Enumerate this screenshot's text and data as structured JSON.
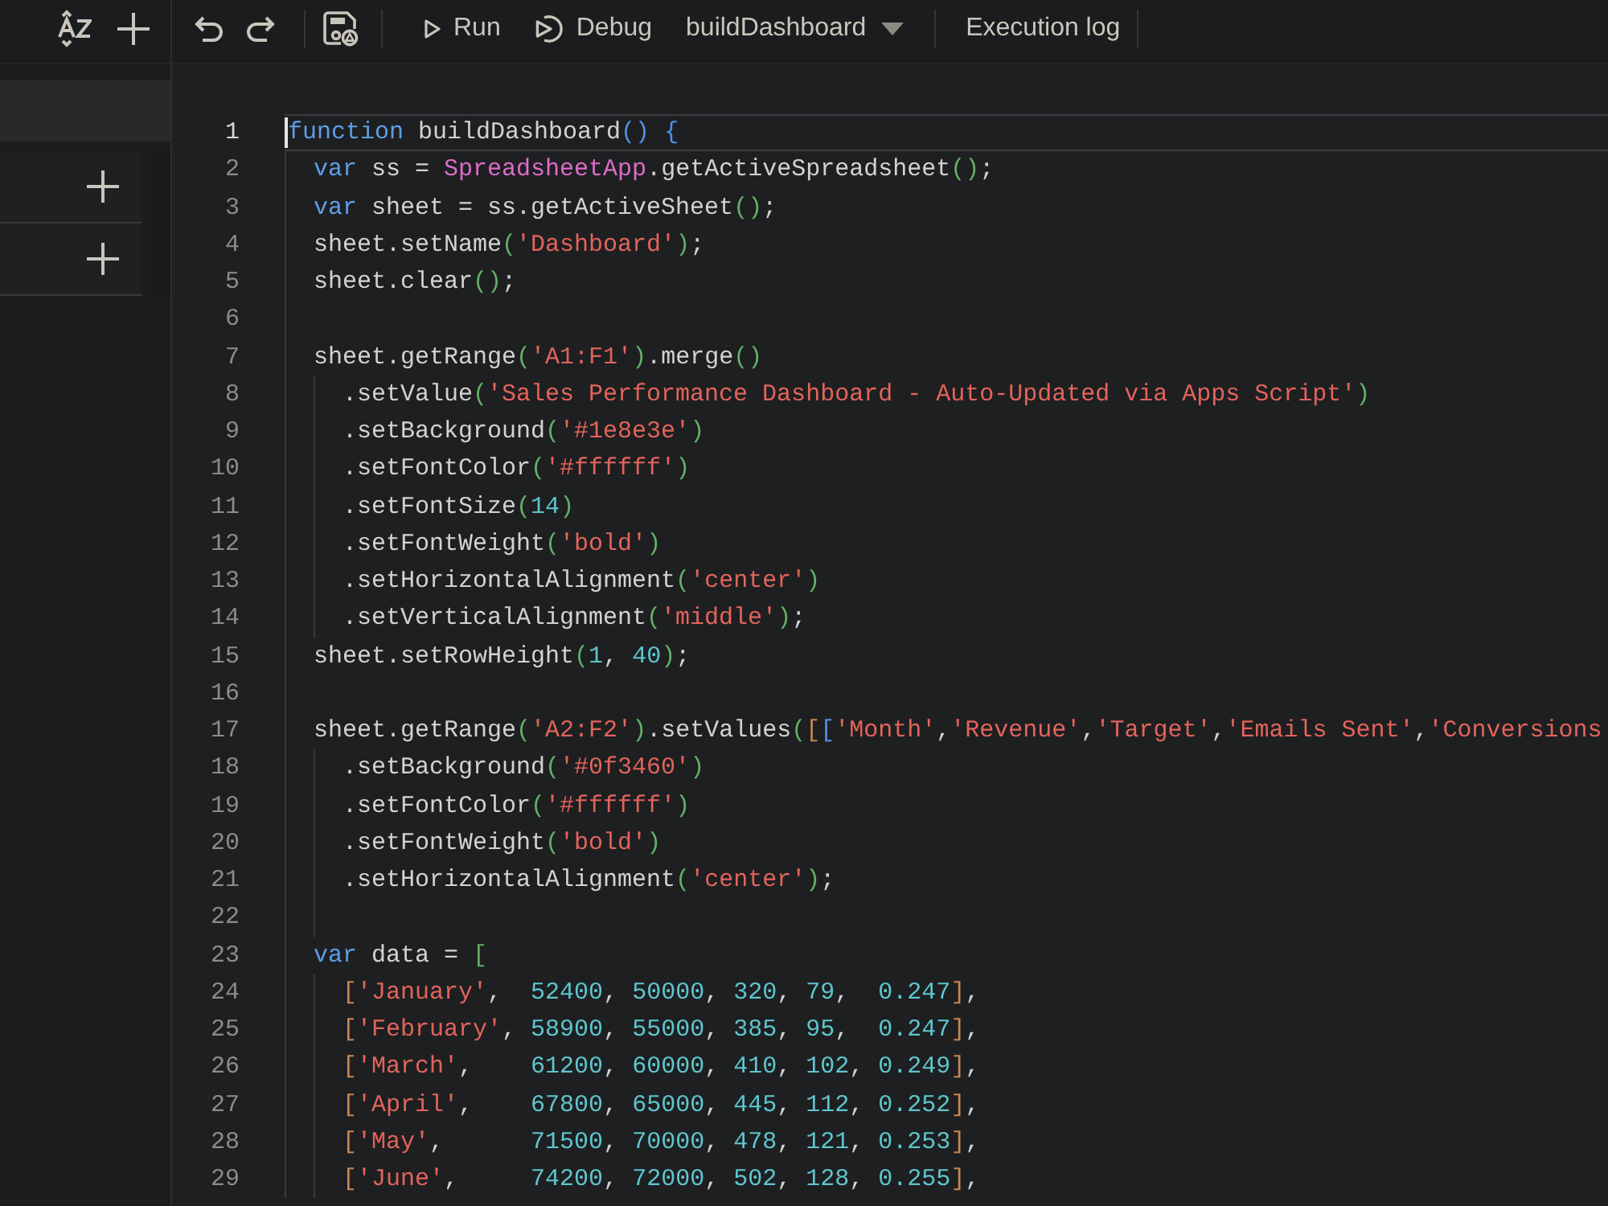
{
  "toolbar": {
    "run": "Run",
    "debug": "Debug",
    "function_select": "buildDashboard",
    "execution_log": "Execution log"
  },
  "sidebar": {
    "rows": [
      {
        "kind": "file"
      },
      {
        "kind": "section"
      },
      {
        "kind": "section"
      }
    ]
  },
  "editor": {
    "lines": [
      {
        "number": "1",
        "current": true,
        "tokens": [
          {
            "kind": "keyword",
            "text": "function"
          },
          {
            "kind": "plain",
            "text": " buildDashboard"
          },
          {
            "kind": "bracket1",
            "text": "()"
          },
          {
            "kind": "bracket1",
            "text": " {"
          }
        ]
      },
      {
        "number": "2",
        "current": false,
        "tokens": [
          {
            "kind": "keyword",
            "text": "  var"
          },
          {
            "kind": "plain",
            "text": " ss = "
          },
          {
            "kind": "type",
            "text": "SpreadsheetApp"
          },
          {
            "kind": "plain",
            "text": ".getActiveSpreadsheet"
          },
          {
            "kind": "bracket2",
            "text": "()"
          },
          {
            "kind": "plain",
            "text": ";"
          }
        ]
      },
      {
        "number": "3",
        "current": false,
        "tokens": [
          {
            "kind": "keyword",
            "text": "  var"
          },
          {
            "kind": "plain",
            "text": " sheet = ss.getActiveSheet"
          },
          {
            "kind": "bracket2",
            "text": "()"
          },
          {
            "kind": "plain",
            "text": ";"
          }
        ]
      },
      {
        "number": "4",
        "current": false,
        "tokens": [
          {
            "kind": "plain",
            "text": "  sheet.setName"
          },
          {
            "kind": "bracket2",
            "text": "("
          },
          {
            "kind": "string",
            "text": "'Dashboard'"
          },
          {
            "kind": "bracket2",
            "text": ")"
          },
          {
            "kind": "plain",
            "text": ";"
          }
        ]
      },
      {
        "number": "5",
        "current": false,
        "tokens": [
          {
            "kind": "plain",
            "text": "  sheet.clear"
          },
          {
            "kind": "bracket2",
            "text": "()"
          },
          {
            "kind": "plain",
            "text": ";"
          }
        ]
      },
      {
        "number": "6",
        "current": false
      },
      {
        "number": "7",
        "current": false,
        "tokens": [
          {
            "kind": "plain",
            "text": "  sheet.getRange"
          },
          {
            "kind": "bracket2",
            "text": "("
          },
          {
            "kind": "string",
            "text": "'A1:F1'"
          },
          {
            "kind": "bracket2",
            "text": ")"
          },
          {
            "kind": "plain",
            "text": ".merge"
          },
          {
            "kind": "bracket2",
            "text": "()"
          }
        ]
      },
      {
        "number": "8",
        "current": false,
        "tokens": [
          {
            "kind": "plain",
            "text": "    .setValue"
          },
          {
            "kind": "bracket2",
            "text": "("
          },
          {
            "kind": "string",
            "text": "'Sales Performance Dashboard - Auto-Updated via Apps Script'"
          },
          {
            "kind": "bracket2",
            "text": ")"
          }
        ]
      },
      {
        "number": "9",
        "current": false,
        "tokens": [
          {
            "kind": "plain",
            "text": "    .setBackground"
          },
          {
            "kind": "bracket2",
            "text": "("
          },
          {
            "kind": "string",
            "text": "'#1e8e3e'"
          },
          {
            "kind": "bracket2",
            "text": ")"
          }
        ]
      },
      {
        "number": "10",
        "current": false,
        "tokens": [
          {
            "kind": "plain",
            "text": "    .setFontColor"
          },
          {
            "kind": "bracket2",
            "text": "("
          },
          {
            "kind": "string",
            "text": "'#ffffff'"
          },
          {
            "kind": "bracket2",
            "text": ")"
          }
        ]
      },
      {
        "number": "11",
        "current": false,
        "tokens": [
          {
            "kind": "plain",
            "text": "    .setFontSize"
          },
          {
            "kind": "bracket2",
            "text": "("
          },
          {
            "kind": "number",
            "text": "14"
          },
          {
            "kind": "bracket2",
            "text": ")"
          }
        ]
      },
      {
        "number": "12",
        "current": false,
        "tokens": [
          {
            "kind": "plain",
            "text": "    .setFontWeight"
          },
          {
            "kind": "bracket2",
            "text": "("
          },
          {
            "kind": "string",
            "text": "'bold'"
          },
          {
            "kind": "bracket2",
            "text": ")"
          }
        ]
      },
      {
        "number": "13",
        "current": false,
        "tokens": [
          {
            "kind": "plain",
            "text": "    .setHorizontalAlignment"
          },
          {
            "kind": "bracket2",
            "text": "("
          },
          {
            "kind": "string",
            "text": "'center'"
          },
          {
            "kind": "bracket2",
            "text": ")"
          }
        ]
      },
      {
        "number": "14",
        "current": false,
        "tokens": [
          {
            "kind": "plain",
            "text": "    .setVerticalAlignment"
          },
          {
            "kind": "bracket2",
            "text": "("
          },
          {
            "kind": "string",
            "text": "'middle'"
          },
          {
            "kind": "bracket2",
            "text": ")"
          },
          {
            "kind": "plain",
            "text": ";"
          }
        ]
      },
      {
        "number": "15",
        "current": false,
        "tokens": [
          {
            "kind": "plain",
            "text": "  sheet.setRowHeight"
          },
          {
            "kind": "bracket2",
            "text": "("
          },
          {
            "kind": "number",
            "text": "1"
          },
          {
            "kind": "plain",
            "text": ", "
          },
          {
            "kind": "number",
            "text": "40"
          },
          {
            "kind": "bracket2",
            "text": ")"
          },
          {
            "kind": "plain",
            "text": ";"
          }
        ]
      },
      {
        "number": "16",
        "current": false
      },
      {
        "number": "17",
        "current": false,
        "tokens": [
          {
            "kind": "plain",
            "text": "  sheet.getRange"
          },
          {
            "kind": "bracket2",
            "text": "("
          },
          {
            "kind": "string",
            "text": "'A2:F2'"
          },
          {
            "kind": "bracket2",
            "text": ")"
          },
          {
            "kind": "plain",
            "text": ".setValues"
          },
          {
            "kind": "bracket2",
            "text": "("
          },
          {
            "kind": "bracket3",
            "text": "["
          },
          {
            "kind": "bracket1",
            "text": "["
          },
          {
            "kind": "string",
            "text": "'Month'"
          },
          {
            "kind": "plain",
            "text": ","
          },
          {
            "kind": "string",
            "text": "'Revenue'"
          },
          {
            "kind": "plain",
            "text": ","
          },
          {
            "kind": "string",
            "text": "'Target'"
          },
          {
            "kind": "plain",
            "text": ","
          },
          {
            "kind": "string",
            "text": "'Emails Sent'"
          },
          {
            "kind": "plain",
            "text": ","
          },
          {
            "kind": "string",
            "text": "'Conversions"
          }
        ]
      },
      {
        "number": "18",
        "current": false,
        "tokens": [
          {
            "kind": "plain",
            "text": "    .setBackground"
          },
          {
            "kind": "bracket2",
            "text": "("
          },
          {
            "kind": "string",
            "text": "'#0f3460'"
          },
          {
            "kind": "bracket2",
            "text": ")"
          }
        ]
      },
      {
        "number": "19",
        "current": false,
        "tokens": [
          {
            "kind": "plain",
            "text": "    .setFontColor"
          },
          {
            "kind": "bracket2",
            "text": "("
          },
          {
            "kind": "string",
            "text": "'#ffffff'"
          },
          {
            "kind": "bracket2",
            "text": ")"
          }
        ]
      },
      {
        "number": "20",
        "current": false,
        "tokens": [
          {
            "kind": "plain",
            "text": "    .setFontWeight"
          },
          {
            "kind": "bracket2",
            "text": "("
          },
          {
            "kind": "string",
            "text": "'bold'"
          },
          {
            "kind": "bracket2",
            "text": ")"
          }
        ]
      },
      {
        "number": "21",
        "current": false,
        "tokens": [
          {
            "kind": "plain",
            "text": "    .setHorizontalAlignment"
          },
          {
            "kind": "bracket2",
            "text": "("
          },
          {
            "kind": "string",
            "text": "'center'"
          },
          {
            "kind": "bracket2",
            "text": ")"
          },
          {
            "kind": "plain",
            "text": ";"
          }
        ]
      },
      {
        "number": "22",
        "current": false
      },
      {
        "number": "23",
        "current": false,
        "tokens": [
          {
            "kind": "keyword",
            "text": "  var"
          },
          {
            "kind": "plain",
            "text": " data = "
          },
          {
            "kind": "bracket2",
            "text": "["
          }
        ]
      },
      {
        "number": "24",
        "current": false,
        "tokens": [
          {
            "kind": "bracket3",
            "text": "    ["
          },
          {
            "kind": "string",
            "text": "'January'"
          },
          {
            "kind": "plain",
            "text": ",  "
          },
          {
            "kind": "number",
            "text": "52400"
          },
          {
            "kind": "plain",
            "text": ", "
          },
          {
            "kind": "number",
            "text": "50000"
          },
          {
            "kind": "plain",
            "text": ", "
          },
          {
            "kind": "number",
            "text": "320"
          },
          {
            "kind": "plain",
            "text": ", "
          },
          {
            "kind": "number",
            "text": "79"
          },
          {
            "kind": "plain",
            "text": ",  "
          },
          {
            "kind": "number",
            "text": "0.247"
          },
          {
            "kind": "bracket3",
            "text": "]"
          },
          {
            "kind": "plain",
            "text": ","
          }
        ]
      },
      {
        "number": "25",
        "current": false,
        "tokens": [
          {
            "kind": "bracket3",
            "text": "    ["
          },
          {
            "kind": "string",
            "text": "'February'"
          },
          {
            "kind": "plain",
            "text": ", "
          },
          {
            "kind": "number",
            "text": "58900"
          },
          {
            "kind": "plain",
            "text": ", "
          },
          {
            "kind": "number",
            "text": "55000"
          },
          {
            "kind": "plain",
            "text": ", "
          },
          {
            "kind": "number",
            "text": "385"
          },
          {
            "kind": "plain",
            "text": ", "
          },
          {
            "kind": "number",
            "text": "95"
          },
          {
            "kind": "plain",
            "text": ",  "
          },
          {
            "kind": "number",
            "text": "0.247"
          },
          {
            "kind": "bracket3",
            "text": "]"
          },
          {
            "kind": "plain",
            "text": ","
          }
        ]
      },
      {
        "number": "26",
        "current": false,
        "tokens": [
          {
            "kind": "bracket3",
            "text": "    ["
          },
          {
            "kind": "string",
            "text": "'March'"
          },
          {
            "kind": "plain",
            "text": ",    "
          },
          {
            "kind": "number",
            "text": "61200"
          },
          {
            "kind": "plain",
            "text": ", "
          },
          {
            "kind": "number",
            "text": "60000"
          },
          {
            "kind": "plain",
            "text": ", "
          },
          {
            "kind": "number",
            "text": "410"
          },
          {
            "kind": "plain",
            "text": ", "
          },
          {
            "kind": "number",
            "text": "102"
          },
          {
            "kind": "plain",
            "text": ", "
          },
          {
            "kind": "number",
            "text": "0.249"
          },
          {
            "kind": "bracket3",
            "text": "]"
          },
          {
            "kind": "plain",
            "text": ","
          }
        ]
      },
      {
        "number": "27",
        "current": false,
        "tokens": [
          {
            "kind": "bracket3",
            "text": "    ["
          },
          {
            "kind": "string",
            "text": "'April'"
          },
          {
            "kind": "plain",
            "text": ",    "
          },
          {
            "kind": "number",
            "text": "67800"
          },
          {
            "kind": "plain",
            "text": ", "
          },
          {
            "kind": "number",
            "text": "65000"
          },
          {
            "kind": "plain",
            "text": ", "
          },
          {
            "kind": "number",
            "text": "445"
          },
          {
            "kind": "plain",
            "text": ", "
          },
          {
            "kind": "number",
            "text": "112"
          },
          {
            "kind": "plain",
            "text": ", "
          },
          {
            "kind": "number",
            "text": "0.252"
          },
          {
            "kind": "bracket3",
            "text": "]"
          },
          {
            "kind": "plain",
            "text": ","
          }
        ]
      },
      {
        "number": "28",
        "current": false,
        "tokens": [
          {
            "kind": "bracket3",
            "text": "    ["
          },
          {
            "kind": "string",
            "text": "'May'"
          },
          {
            "kind": "plain",
            "text": ",      "
          },
          {
            "kind": "number",
            "text": "71500"
          },
          {
            "kind": "plain",
            "text": ", "
          },
          {
            "kind": "number",
            "text": "70000"
          },
          {
            "kind": "plain",
            "text": ", "
          },
          {
            "kind": "number",
            "text": "478"
          },
          {
            "kind": "plain",
            "text": ", "
          },
          {
            "kind": "number",
            "text": "121"
          },
          {
            "kind": "plain",
            "text": ", "
          },
          {
            "kind": "number",
            "text": "0.253"
          },
          {
            "kind": "bracket3",
            "text": "]"
          },
          {
            "kind": "plain",
            "text": ","
          }
        ]
      },
      {
        "number": "29",
        "current": false,
        "tokens": [
          {
            "kind": "bracket3",
            "text": "    ["
          },
          {
            "kind": "string",
            "text": "'June'"
          },
          {
            "kind": "plain",
            "text": ",     "
          },
          {
            "kind": "number",
            "text": "74200"
          },
          {
            "kind": "plain",
            "text": ", "
          },
          {
            "kind": "number",
            "text": "72000"
          },
          {
            "kind": "plain",
            "text": ", "
          },
          {
            "kind": "number",
            "text": "502"
          },
          {
            "kind": "plain",
            "text": ", "
          },
          {
            "kind": "number",
            "text": "128"
          },
          {
            "kind": "plain",
            "text": ", "
          },
          {
            "kind": "number",
            "text": "0.255"
          },
          {
            "kind": "bracket3",
            "text": "]"
          },
          {
            "kind": "plain",
            "text": ","
          }
        ]
      }
    ]
  }
}
